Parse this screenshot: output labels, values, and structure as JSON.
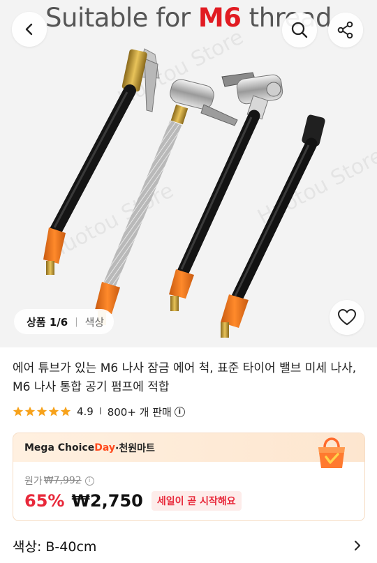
{
  "hero": {
    "caption_prefix": "Suitable for ",
    "caption_accent": "M6",
    "caption_suffix": " thread",
    "watermark": "Huotou Store",
    "accent_color": "#e11b22"
  },
  "nav": {
    "back_icon": "chevron-left-icon",
    "search_icon": "search-icon",
    "share_icon": "share-icon",
    "wishlist_icon": "heart-icon"
  },
  "gallery": {
    "counter": "상품 1/6",
    "separator": "|",
    "color_tab": "색상"
  },
  "product": {
    "title": "에어 튜브가 있는 M6 나사 잠금 에어 척, 표준 타이어 밸브 미세 나사, M6 나사 통합 공기 펌프에 적합"
  },
  "rating": {
    "score": "4.9",
    "separator": "I",
    "sold": "800+ 개 판매",
    "info_icon": "info-icon",
    "star_color": "#f7a21b"
  },
  "promo": {
    "brand_prefix": "Mega Choice",
    "brand_day": "Day",
    "brand_suffix": "·천원마트",
    "original_label": "원가",
    "original_price": "₩7,992",
    "discount": "65%",
    "price": "₩2,750",
    "sale_tag": "세일이 곧 시작해요",
    "day_color": "#ff4a1d",
    "price_color": "#e8283a"
  },
  "variant": {
    "label": "색상: B-40cm",
    "chevron_icon": "chevron-right-icon"
  }
}
